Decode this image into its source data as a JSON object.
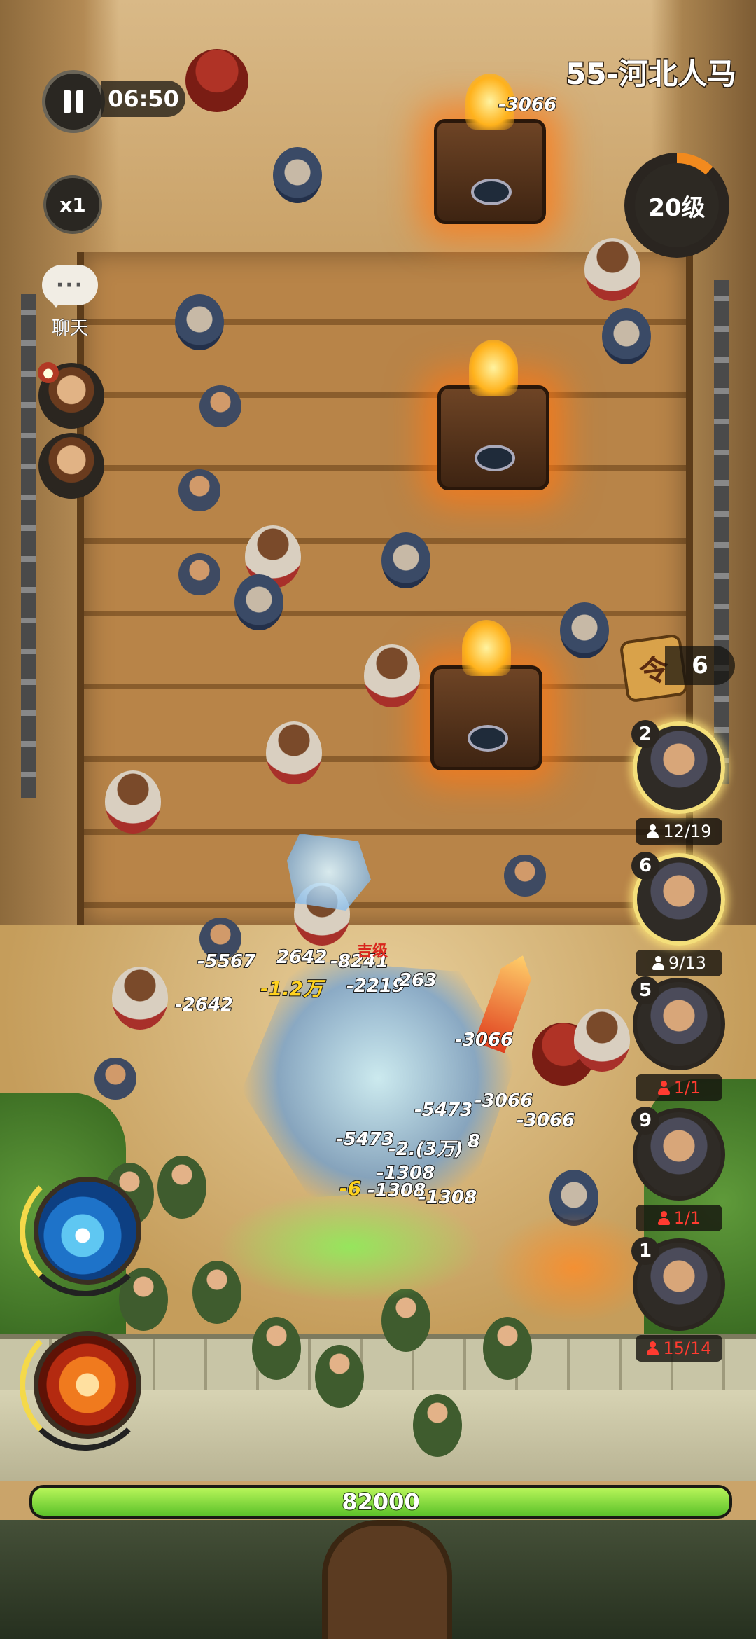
{
  "stage": {
    "title": "55-河北人马"
  },
  "timer": {
    "value": "06:50"
  },
  "speed": {
    "label": "x1"
  },
  "chat": {
    "icon_text": "···",
    "label": "聊天"
  },
  "level": {
    "label": "20级",
    "progress": 0.12
  },
  "command_tokens": {
    "icon": "令",
    "count": "6"
  },
  "heroes": [
    {
      "level": "2",
      "count": "12/19",
      "ready": true,
      "count_color": "#ffffff"
    },
    {
      "level": "6",
      "count": "9/13",
      "ready": true,
      "count_color": "#ffffff"
    },
    {
      "level": "5",
      "count": "1/1",
      "ready": false,
      "count_color": "#ff3b30"
    },
    {
      "level": "9",
      "count": "1/1",
      "ready": false,
      "count_color": "#ff3b30"
    },
    {
      "level": "1",
      "count": "15/14",
      "ready": false,
      "count_color": "#ff3b30"
    }
  ],
  "damage_numbers": {
    "d1": "-3066",
    "d2": "-5567",
    "d3": "2642",
    "d4": "-8241",
    "d5": "-1.2万",
    "d6": "-2219",
    "d7": "263",
    "d8": "-2642",
    "d9": "-3066",
    "d10": "-5473",
    "d11": "-3066",
    "d12": "-3066",
    "d13": "-5473",
    "d14": "-2.(3万)",
    "d15": "8",
    "d16": "-1308",
    "d17": "-6",
    "d18": "-1308",
    "d19": "-1308"
  },
  "enemy_label": "吉级",
  "base_hp": {
    "value": "82000",
    "fraction": 1.0
  },
  "skills": {
    "skill1": "wave-skill-icon",
    "skill2": "fire-hammer-skill-icon"
  },
  "colors": {
    "accent": "#f4d94a",
    "hp_green": "#5cc22a",
    "warning_red": "#ff3b30"
  }
}
